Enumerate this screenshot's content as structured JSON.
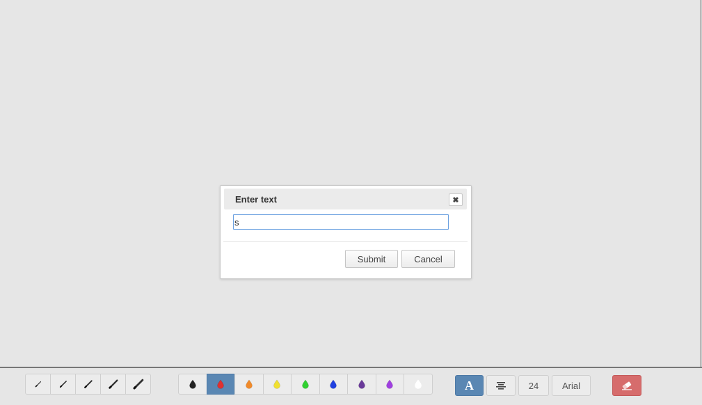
{
  "dialog": {
    "title": "Enter text",
    "close_icon": "close-icon",
    "input_value": "s",
    "submit_label": "Submit",
    "cancel_label": "Cancel"
  },
  "toolbar": {
    "pencil_sizes": [
      {
        "name": "pencil-size-1",
        "icon": "pencil-icon"
      },
      {
        "name": "pencil-size-2",
        "icon": "pencil-icon"
      },
      {
        "name": "pencil-size-3",
        "icon": "pencil-icon"
      },
      {
        "name": "pencil-size-4",
        "icon": "pencil-icon"
      },
      {
        "name": "pencil-size-5",
        "icon": "pencil-icon"
      }
    ],
    "colors": [
      {
        "name": "black",
        "hex": "#222222",
        "icon": "drop-icon"
      },
      {
        "name": "red",
        "hex": "#e03030",
        "icon": "drop-icon",
        "active": true
      },
      {
        "name": "orange",
        "hex": "#f08a2a",
        "icon": "drop-icon"
      },
      {
        "name": "yellow",
        "hex": "#f0e030",
        "icon": "drop-icon"
      },
      {
        "name": "green",
        "hex": "#30d030",
        "icon": "drop-icon"
      },
      {
        "name": "blue",
        "hex": "#2040e0",
        "icon": "drop-icon"
      },
      {
        "name": "purple",
        "hex": "#6a3a9a",
        "icon": "drop-icon"
      },
      {
        "name": "violet",
        "hex": "#a040e0",
        "icon": "drop-icon"
      },
      {
        "name": "white",
        "hex": "#ffffff",
        "icon": "drop-icon"
      }
    ],
    "text_tool_label": "A",
    "align_icon": "align-center-icon",
    "font_size": "24",
    "font_family": "Arial",
    "eraser_icon": "eraser-icon"
  },
  "colors": {
    "active_button": "#5a87b3",
    "eraser_button": "#d66c6c",
    "input_focus_border": "#6aa0e0"
  }
}
